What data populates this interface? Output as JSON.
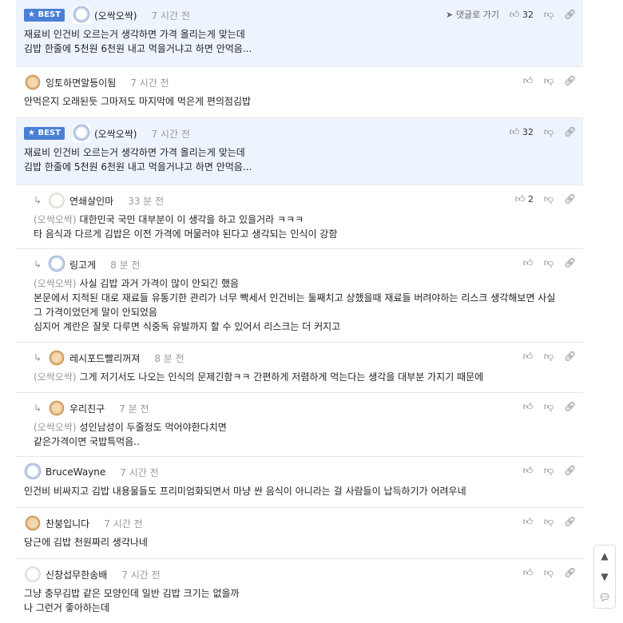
{
  "labels": {
    "best": "BEST",
    "goto_reply": "댓글로 가기"
  },
  "comments": [
    {
      "best": true,
      "nick": "(오싹오싹)",
      "time": "7 시간 전",
      "likes": "32",
      "goto": true,
      "lines": [
        "재료비 인건비 오르는거 생각하면 가격 올리는게 맞는데",
        "김밥 한줄에 5천원 6천원 내고 먹을거냐고 하면 안먹음..."
      ]
    },
    {
      "best": false,
      "nick": "잉토하면알등이됨",
      "time": "7 시간 전",
      "likes": "",
      "lines": [
        "안먹은지 오래된듯 그마저도 마지막에 먹은게 편의점김밥"
      ]
    },
    {
      "best": true,
      "nick": "(오싹오싹)",
      "time": "7 시간 전",
      "likes": "32",
      "lines": [
        "재료비 인건비 오르는거 생각하면 가격 올리는게 맞는데",
        "김밥 한줄에 5천원 6천원 내고 먹을거냐고 하면 안먹음..."
      ]
    },
    {
      "reply": true,
      "nick": "연쇄살인마",
      "time": "33 분 전",
      "likes": "2",
      "mention": "(오싹오싹)",
      "lines": [
        "대한민국 국민 대부분이 이 생각을 하고 있을거라 ㅋㅋㅋ",
        "타 음식과 다르게 김밥은 이전 가격에 머물러야 된다고 생각되는 인식이 강함"
      ]
    },
    {
      "reply": true,
      "nick": "링고게",
      "time": "8 분 전",
      "likes": "",
      "mention": "(오싹오싹)",
      "lines": [
        "사실 김밥 과거 가격이 많이 안되긴 했음",
        "본문에서 지적된 대로 재료들 유통기한 관리가 너무 빡세서 인건비는 둘째치고 상했을때 재료들 버려야하는 리스크 생각해보면 사실",
        "그 가격이었던게 말이 안되었음",
        "심지어 계란은 잘못 다루면 식중독 유발까지 할 수 있어서 리스크는 더 커지고"
      ]
    },
    {
      "reply": true,
      "nick": "레시포드빨리꺼져",
      "time": "8 분 전",
      "likes": "",
      "mention": "(오싹오싹)",
      "lines": [
        "그게 저기서도 나오는 인식의 문제긴함ㅋㅋ 간편하게 저렴하게 먹는다는 생각을 대부분 가지기 때문에"
      ]
    },
    {
      "reply": true,
      "nick": "우리친구",
      "time": "7 분 전",
      "likes": "",
      "mention": "(오싹오싹)",
      "lines": [
        "성인남성이 두줄정도 먹어야한다치면",
        "같은가격이면 국밥특먹음.."
      ]
    },
    {
      "best": false,
      "nick": "BruceWayne",
      "time": "7 시간 전",
      "likes": "",
      "lines": [
        "인건비 비싸지고 김밥 내용물들도 프리미엄화되면서 마냥 싼 음식이 아니라는 걸 사람들이 납득하기가 어려우네"
      ]
    },
    {
      "best": false,
      "nick": "찬붕입니다",
      "time": "7 시간 전",
      "likes": "",
      "lines": [
        "당근에 김밥 천원짜리 생각나네"
      ]
    },
    {
      "best": false,
      "nick": "신창섭무한송배",
      "time": "7 시간 전",
      "likes": "",
      "lines": [
        "그냥 충무김밥 같은 모양인데 일반 김밥 크기는 없을까",
        "나 그런거 좋아하는데"
      ]
    }
  ]
}
